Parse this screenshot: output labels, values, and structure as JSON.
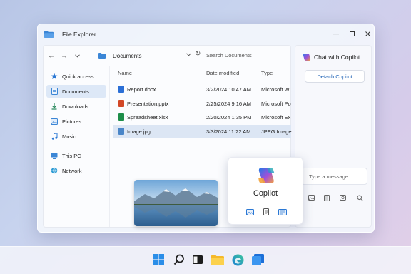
{
  "window": {
    "title": "File Explorer"
  },
  "toolbar": {
    "address": "Documents",
    "search_placeholder": "Search Documents"
  },
  "sidebar": {
    "items": [
      {
        "label": "Quick access",
        "icon": "star-icon"
      },
      {
        "label": "Documents",
        "icon": "documents-icon",
        "active": true
      },
      {
        "label": "Downloads",
        "icon": "download-icon"
      },
      {
        "label": "Pictures",
        "icon": "pictures-icon"
      },
      {
        "label": "Music",
        "icon": "music-icon"
      },
      {
        "label": "This PC",
        "icon": "pc-icon"
      },
      {
        "label": "Network",
        "icon": "network-icon"
      }
    ]
  },
  "files": {
    "columns": [
      "Name",
      "Date modified",
      "Type"
    ],
    "rows": [
      {
        "name": "Report.docx",
        "date": "3/2/2024 10:47 AM",
        "type": "Microsoft W",
        "icon": "word-icon",
        "color": "#2b6fd6"
      },
      {
        "name": "Presentation.pptx",
        "date": "2/25/2024 9:16 AM",
        "type": "Microsoft Po",
        "icon": "powerpoint-icon",
        "color": "#d24726"
      },
      {
        "name": "Spreadsheet.xlsx",
        "date": "2/20/2024 1:35 PM",
        "type": "Microsoft Ex",
        "icon": "excel-icon",
        "color": "#1e8e4a"
      },
      {
        "name": "Image.jpg",
        "date": "3/3/2024 11:22 AM",
        "type": "JPEG Image",
        "icon": "image-icon",
        "color": "#4a86c8",
        "selected": true
      }
    ]
  },
  "copilot_card": {
    "name": "Copilot"
  },
  "chat": {
    "title": "Chat with Copilot",
    "detach_label": "Detach Copilot",
    "input_placeholder": "Type a message"
  },
  "taskbar": {
    "icons": [
      "windows-start-icon",
      "search-icon",
      "task-view-icon",
      "file-explorer-icon",
      "edge-icon",
      "copilot-taskbar-icon"
    ]
  },
  "colors": {
    "accent": "#1a5fb4",
    "selection": "#dce6f4"
  }
}
